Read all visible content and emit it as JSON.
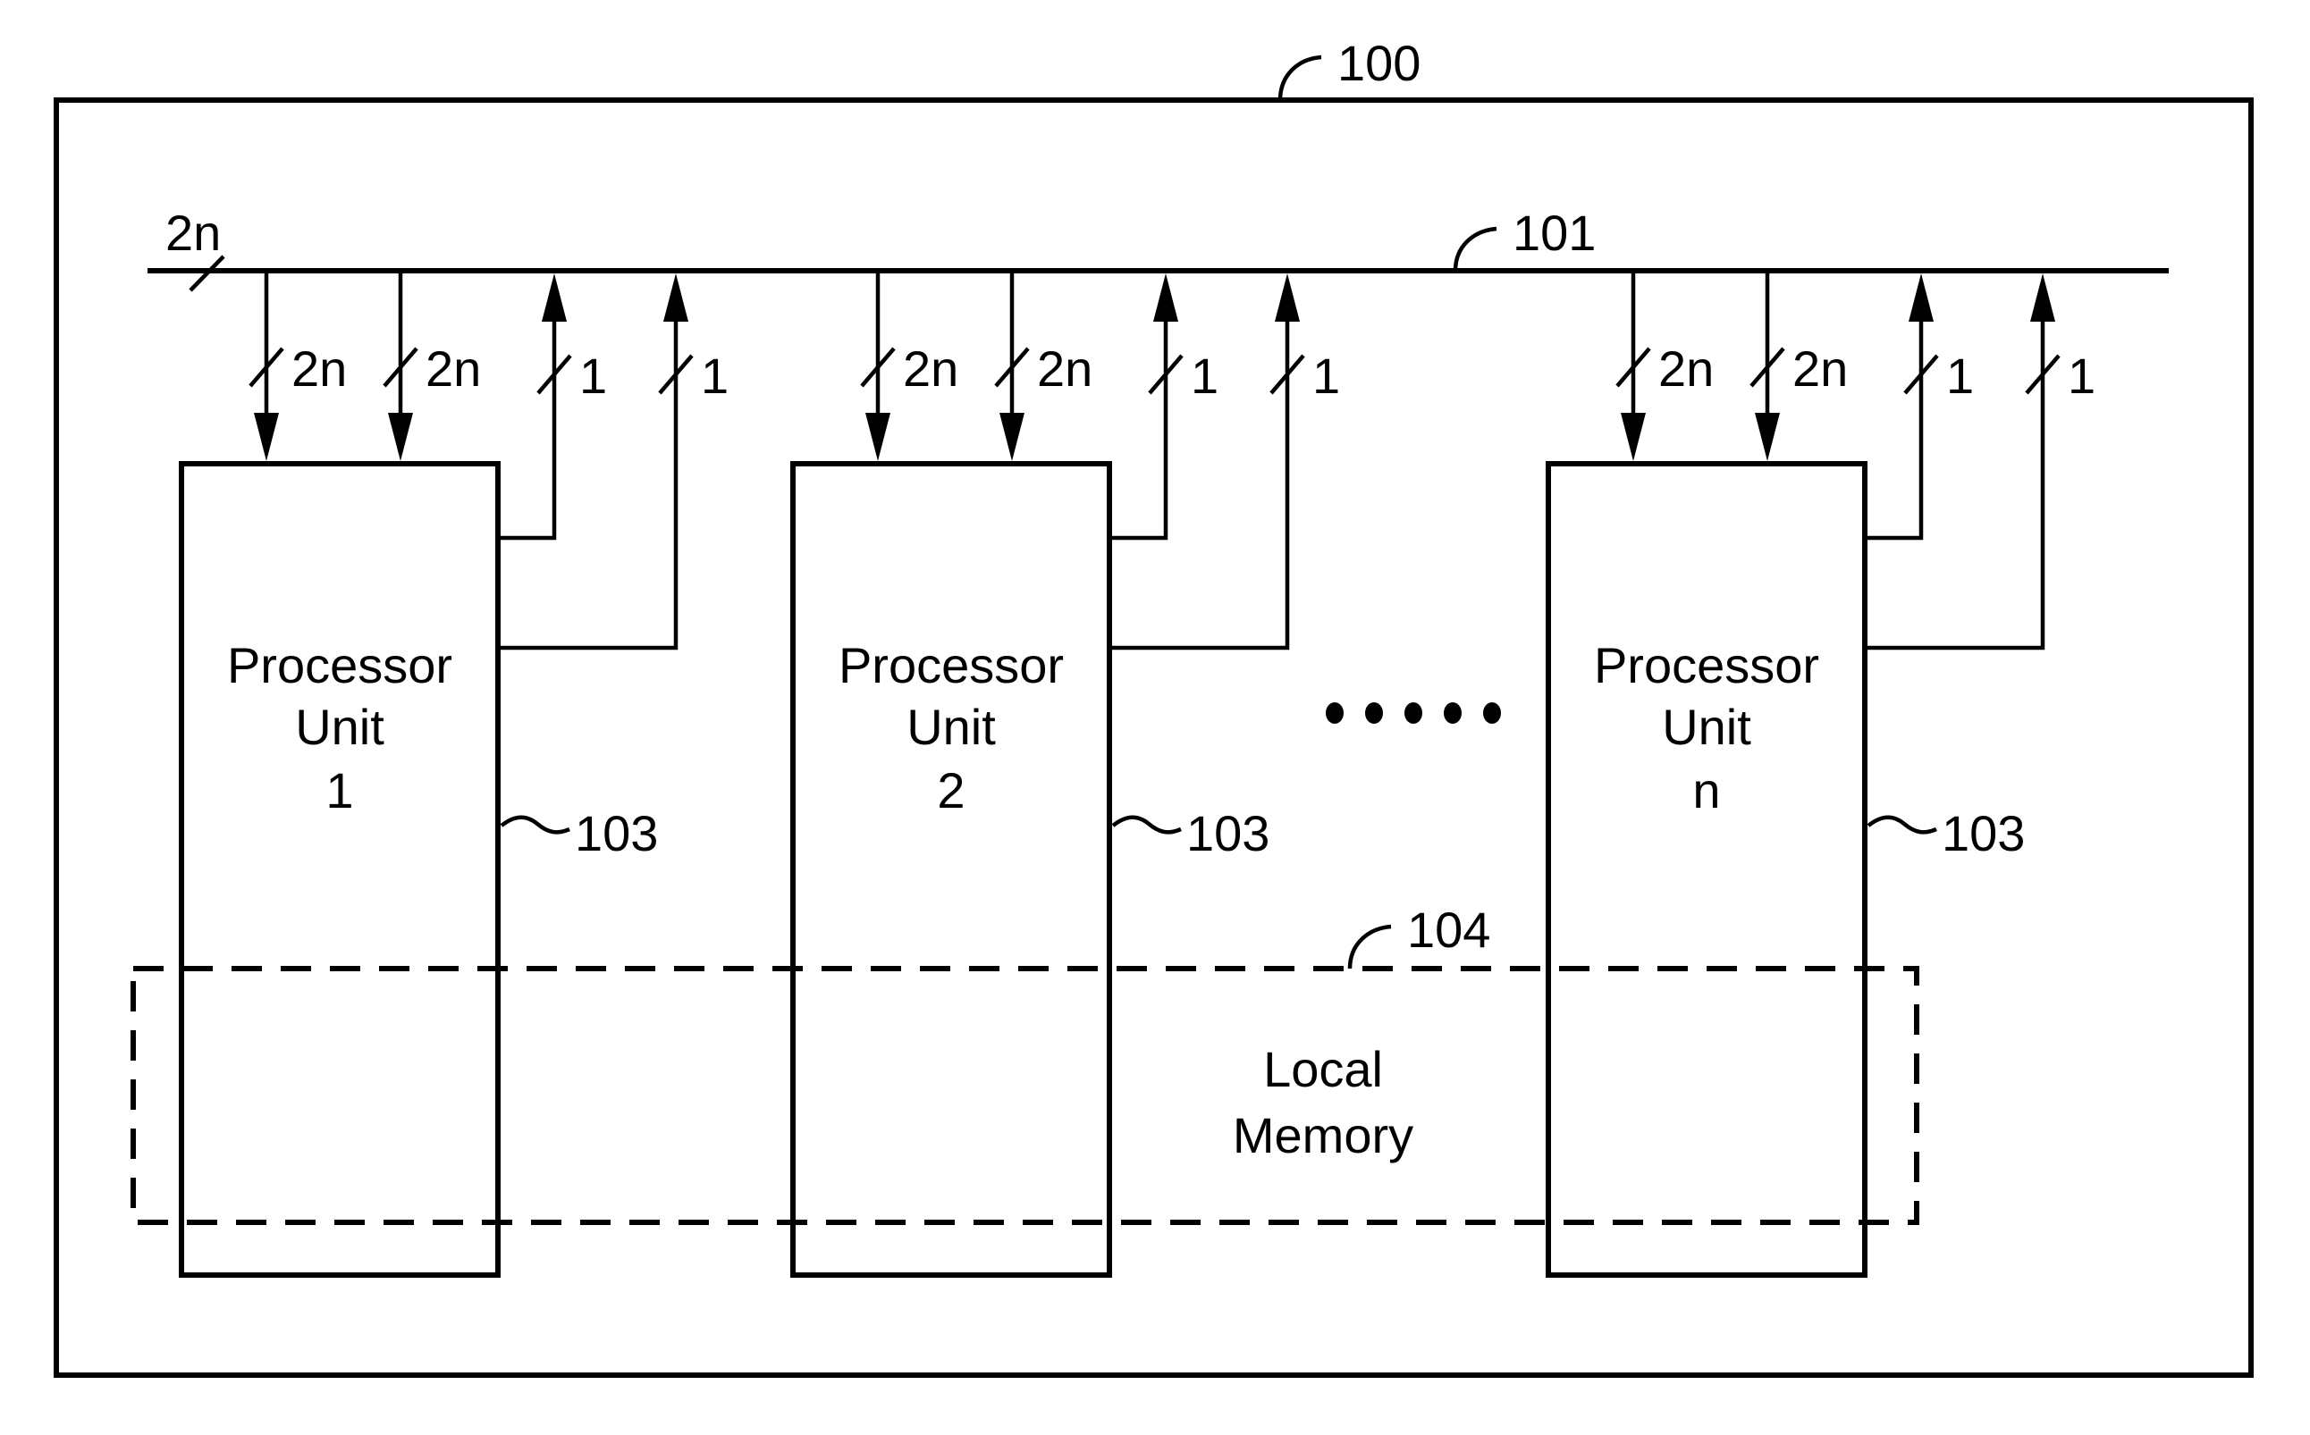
{
  "figure": {
    "outer_ref": "100",
    "bus_ref": "101",
    "bus_width_label": "2n",
    "processor_ref": "103",
    "memory_ref": "104",
    "memory_label_line1": "Local",
    "memory_label_line2": "Memory",
    "ellipsis_dot_count": 5,
    "processor_units": [
      {
        "line1": "Processor",
        "line2": "Unit",
        "line3": "1",
        "inputs": [
          "2n",
          "2n"
        ],
        "outputs": [
          "1",
          "1"
        ]
      },
      {
        "line1": "Processor",
        "line2": "Unit",
        "line3": "2",
        "inputs": [
          "2n",
          "2n"
        ],
        "outputs": [
          "1",
          "1"
        ]
      },
      {
        "line1": "Processor",
        "line2": "Unit",
        "line3": "n",
        "inputs": [
          "2n",
          "2n"
        ],
        "outputs": [
          "1",
          "1"
        ]
      }
    ]
  }
}
